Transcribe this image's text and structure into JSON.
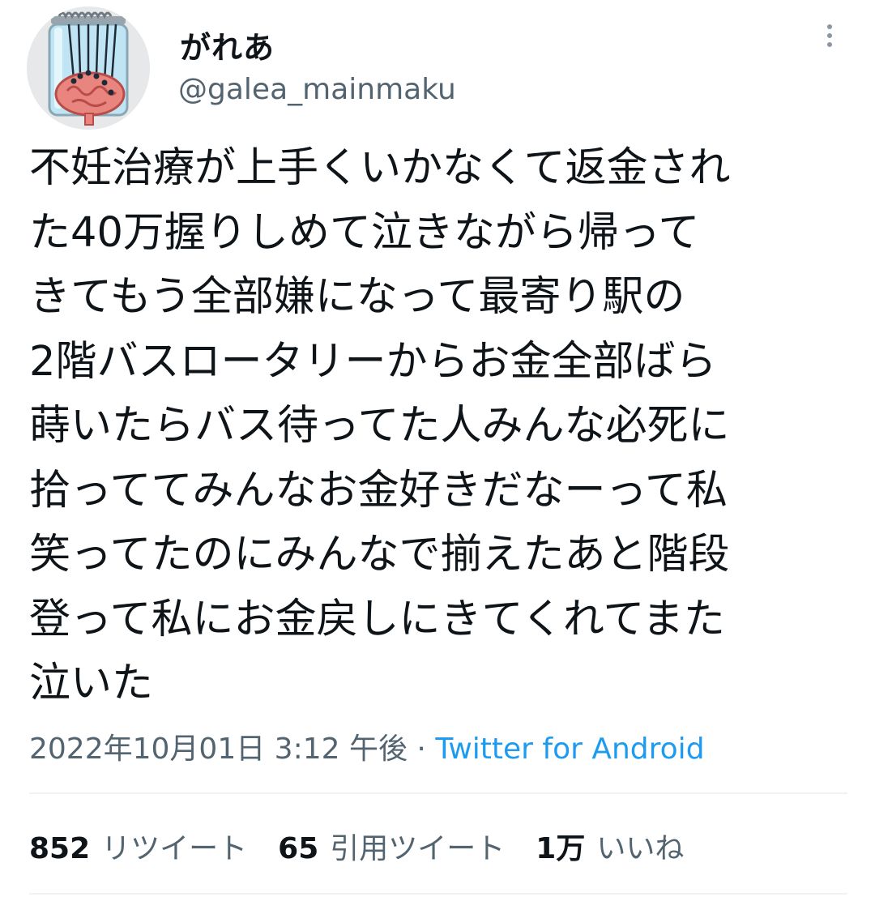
{
  "user": {
    "display_name": "がれあ",
    "handle": "@galea_mainmaku",
    "avatar_icon": "brain-in-jar-icon"
  },
  "tweet": {
    "lines": [
      "不妊治療が上手くいかなくて返金され",
      "た40万握りしめて泣きながら帰って",
      "きてもう全部嫌になって最寄り駅の",
      "2階バスロータリーからお金全部ばら",
      "蒔いたらバス待ってた人みんな必死に",
      "拾っててみんなお金好きだなーって私",
      "笑ってたのにみんなで揃えたあと階段",
      "登って私にお金戻しにきてくれてまた",
      "泣いた"
    ],
    "timestamp": "2022年10月01日 3:12 午後",
    "separator": " · ",
    "source": "Twitter for Android"
  },
  "stats": {
    "retweets": {
      "count": "852",
      "label": "リツイート"
    },
    "quotes": {
      "count": "65",
      "label": "引用ツイート"
    },
    "likes": {
      "count": "1万",
      "label": "いいね"
    }
  },
  "colors": {
    "text": "#0f1419",
    "secondary": "#536471",
    "link": "#1d9bf0",
    "divider": "#eff3f4"
  }
}
